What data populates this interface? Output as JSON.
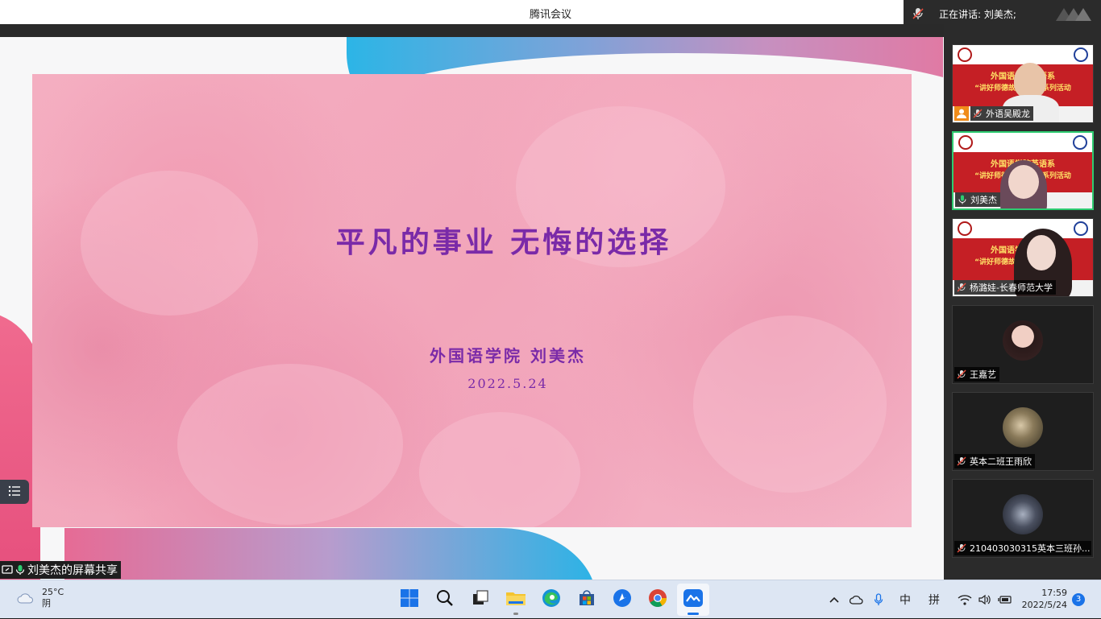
{
  "window": {
    "title": "腾讯会议"
  },
  "speaker": {
    "text": "正在讲话: 刘美杰;"
  },
  "slide": {
    "title": "平凡的事业  无悔的选择",
    "author": "外国语学院   刘美杰",
    "date": "2022.5.24"
  },
  "share": {
    "label": "刘美杰的屏幕共享"
  },
  "banner": {
    "line1": "外国语学院英语系",
    "line2": "“讲好师德故事”主题系列活动"
  },
  "participants": [
    {
      "name": "外语吴殿龙",
      "host": true,
      "active": false,
      "video": true
    },
    {
      "name": "刘美杰",
      "host": false,
      "active": true,
      "video": true
    },
    {
      "name": "杨潞娃-长春师范大学",
      "host": false,
      "active": false,
      "video": true
    },
    {
      "name": "王嘉艺",
      "host": false,
      "active": false,
      "video": false
    },
    {
      "name": "英本二班王雨欣",
      "host": false,
      "active": false,
      "video": false
    },
    {
      "name": "210403030315英本三班孙...",
      "host": false,
      "active": false,
      "video": false
    }
  ],
  "taskbar": {
    "weather": {
      "temp": "25°C",
      "condition": "阴"
    },
    "apps": [
      "windows-start",
      "search",
      "task-view",
      "file-explorer",
      "edge",
      "microsoft-store",
      "feishu",
      "chrome",
      "tencent-meeting"
    ],
    "tray": {
      "ime_lang": "中",
      "ime_mode": "拼"
    },
    "clock": {
      "time": "17:59",
      "date": "2022/5/24"
    },
    "notifications": "3"
  }
}
